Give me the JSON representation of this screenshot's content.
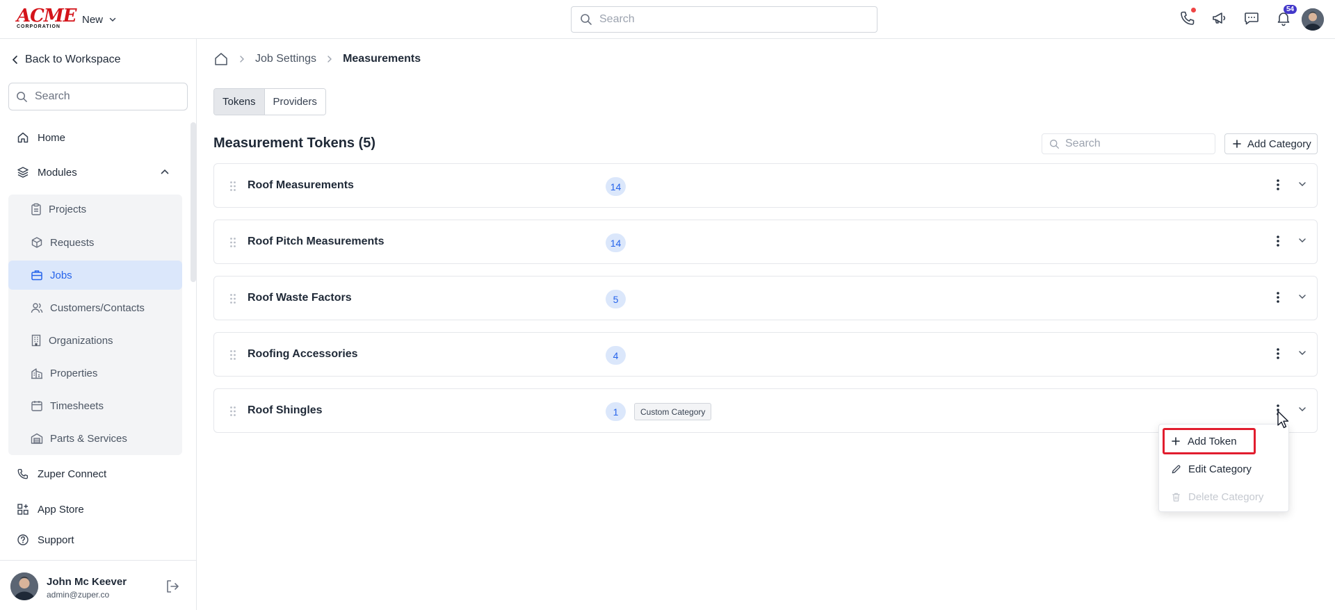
{
  "header": {
    "logo_main": "ACME",
    "logo_sub": "CORPORATION",
    "new_label": "New",
    "search_placeholder": "Search",
    "notification_count": "54"
  },
  "sidebar": {
    "back_label": "Back to Workspace",
    "search_placeholder": "Search",
    "home_label": "Home",
    "modules_label": "Modules",
    "modules": [
      {
        "label": "Projects"
      },
      {
        "label": "Requests"
      },
      {
        "label": "Jobs",
        "active": true
      },
      {
        "label": "Customers/Contacts"
      },
      {
        "label": "Organizations"
      },
      {
        "label": "Properties"
      },
      {
        "label": "Timesheets"
      },
      {
        "label": "Parts & Services"
      }
    ],
    "zuper_connect_label": "Zuper Connect",
    "app_store_label": "App Store",
    "support_label": "Support",
    "user": {
      "name": "John Mc Keever",
      "email": "admin@zuper.co"
    }
  },
  "breadcrumb": {
    "parent": "Job Settings",
    "current": "Measurements"
  },
  "tabs": [
    {
      "label": "Tokens",
      "active": true
    },
    {
      "label": "Providers",
      "active": false
    }
  ],
  "section": {
    "title": "Measurement Tokens (5)",
    "search_placeholder": "Search",
    "add_category_label": "Add Category"
  },
  "categories": [
    {
      "name": "Roof Measurements",
      "count": "14"
    },
    {
      "name": "Roof Pitch Measurements",
      "count": "14"
    },
    {
      "name": "Roof Waste Factors",
      "count": "5"
    },
    {
      "name": "Roofing Accessories",
      "count": "4"
    },
    {
      "name": "Roof Shingles",
      "count": "1",
      "tag": "Custom Category"
    }
  ],
  "context_menu": {
    "add_token": "Add Token",
    "edit_category": "Edit Category",
    "delete_category": "Delete Category"
  },
  "colors": {
    "accent": "#2563eb",
    "active_bg": "#dbe7fb",
    "brand_red": "#d4141a",
    "highlight_border": "#e11d2e"
  }
}
